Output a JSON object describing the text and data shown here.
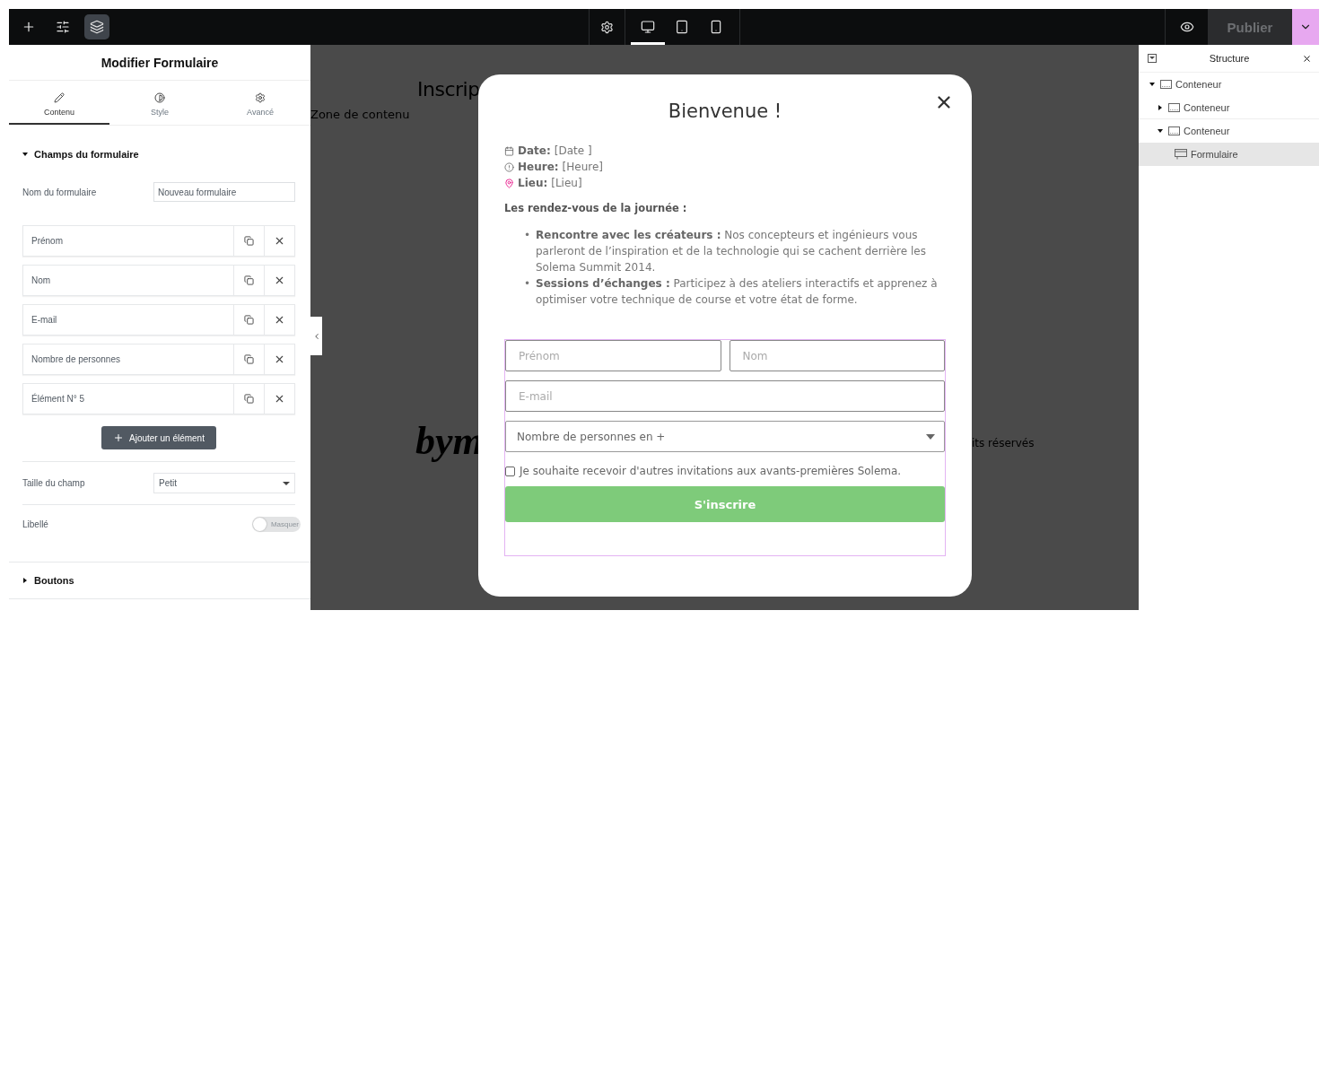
{
  "toolbar": {
    "left_tools": [
      {
        "kind": "add",
        "selected": false
      },
      {
        "kind": "sliders",
        "selected": false
      },
      {
        "kind": "layers",
        "selected": true
      }
    ],
    "site_settings": {
      "kind": "gear"
    },
    "devices": [
      {
        "kind": "desktop",
        "selected": true
      },
      {
        "kind": "tablet",
        "selected": false
      },
      {
        "kind": "phone",
        "selected": false
      }
    ],
    "preview": {
      "kind": "eye"
    },
    "publish": {
      "label": "Publier",
      "disabled": true
    }
  },
  "editor_panel": {
    "title": "Modifier Formulaire",
    "tabs": [
      {
        "label": "Contenu",
        "kind": "pencil",
        "selected": true
      },
      {
        "label": "Style",
        "kind": "contrast",
        "selected": false
      },
      {
        "label": "Avancé",
        "kind": "gear",
        "selected": false
      }
    ],
    "fields_section": {
      "title": "Champs du formulaire",
      "expanded": true,
      "form_name": {
        "label": "Nom du formulaire",
        "value": "Nouveau formulaire"
      },
      "items": [
        "Prénom",
        "Nom",
        "E-mail",
        "Nombre de personnes",
        "Élément N° 5"
      ],
      "add_button": "Ajouter un élément",
      "field_size": {
        "label": "Taille du champ",
        "value": "Petit"
      },
      "label_toggle": {
        "label": "Libellé",
        "on": false,
        "text": "Masquer"
      }
    },
    "buttons_section": {
      "title": "Boutons",
      "expanded": false
    }
  },
  "canvas": {
    "heading": "Inscrip",
    "content_zone": "Zone de contenu",
    "logo": "bym",
    "footer_text": "its réservés"
  },
  "modal": {
    "title": "Bienvenue !",
    "info": [
      {
        "kind": "date",
        "label": "Date:",
        "value": "[Date ]"
      },
      {
        "kind": "time",
        "label": "Heure:",
        "value": "[Heure]"
      },
      {
        "kind": "place",
        "label": "Lieu:",
        "value": "[Lieu]"
      }
    ],
    "agenda_title": "Les rendez-vous de la journée :",
    "agenda": [
      {
        "marker": "•",
        "text": "**Rencontre avec les créateurs :** Nos concepteurs et ingénieurs vous parleront de l’inspiration et de la technologie qui se cachent derrière les Solema Summit 2014."
      },
      {
        "marker": "•",
        "text": "**Sessions d’échanges :** Participez à des ateliers interactifs et apprenez à optimiser votre technique de course et votre état de forme."
      }
    ],
    "form": {
      "fields": [
        {
          "kind": "half",
          "placeholder": "Prénom"
        },
        {
          "kind": "half",
          "placeholder": "Nom"
        },
        {
          "kind": "full",
          "placeholder": "E-mail"
        },
        {
          "kind": "select",
          "value": "Nombre de personnes en +"
        }
      ],
      "consent": {
        "label": "Je souhaite recevoir d'autres invitations aux avants-premières Solema.",
        "checked": false
      },
      "submit": "S'inscrire"
    }
  },
  "structure": {
    "title": "Structure",
    "tree": [
      {
        "label": "Conteneur",
        "kind": "container",
        "expanded": true,
        "selected": false,
        "children": [
          {
            "label": "Conteneur",
            "kind": "container",
            "expanded": false,
            "selected": false
          },
          {
            "label": "Conteneur",
            "kind": "container",
            "expanded": true,
            "selected": false,
            "children": [
              {
                "label": "Formulaire",
                "kind": "form",
                "selected": true
              }
            ]
          }
        ]
      }
    ]
  }
}
